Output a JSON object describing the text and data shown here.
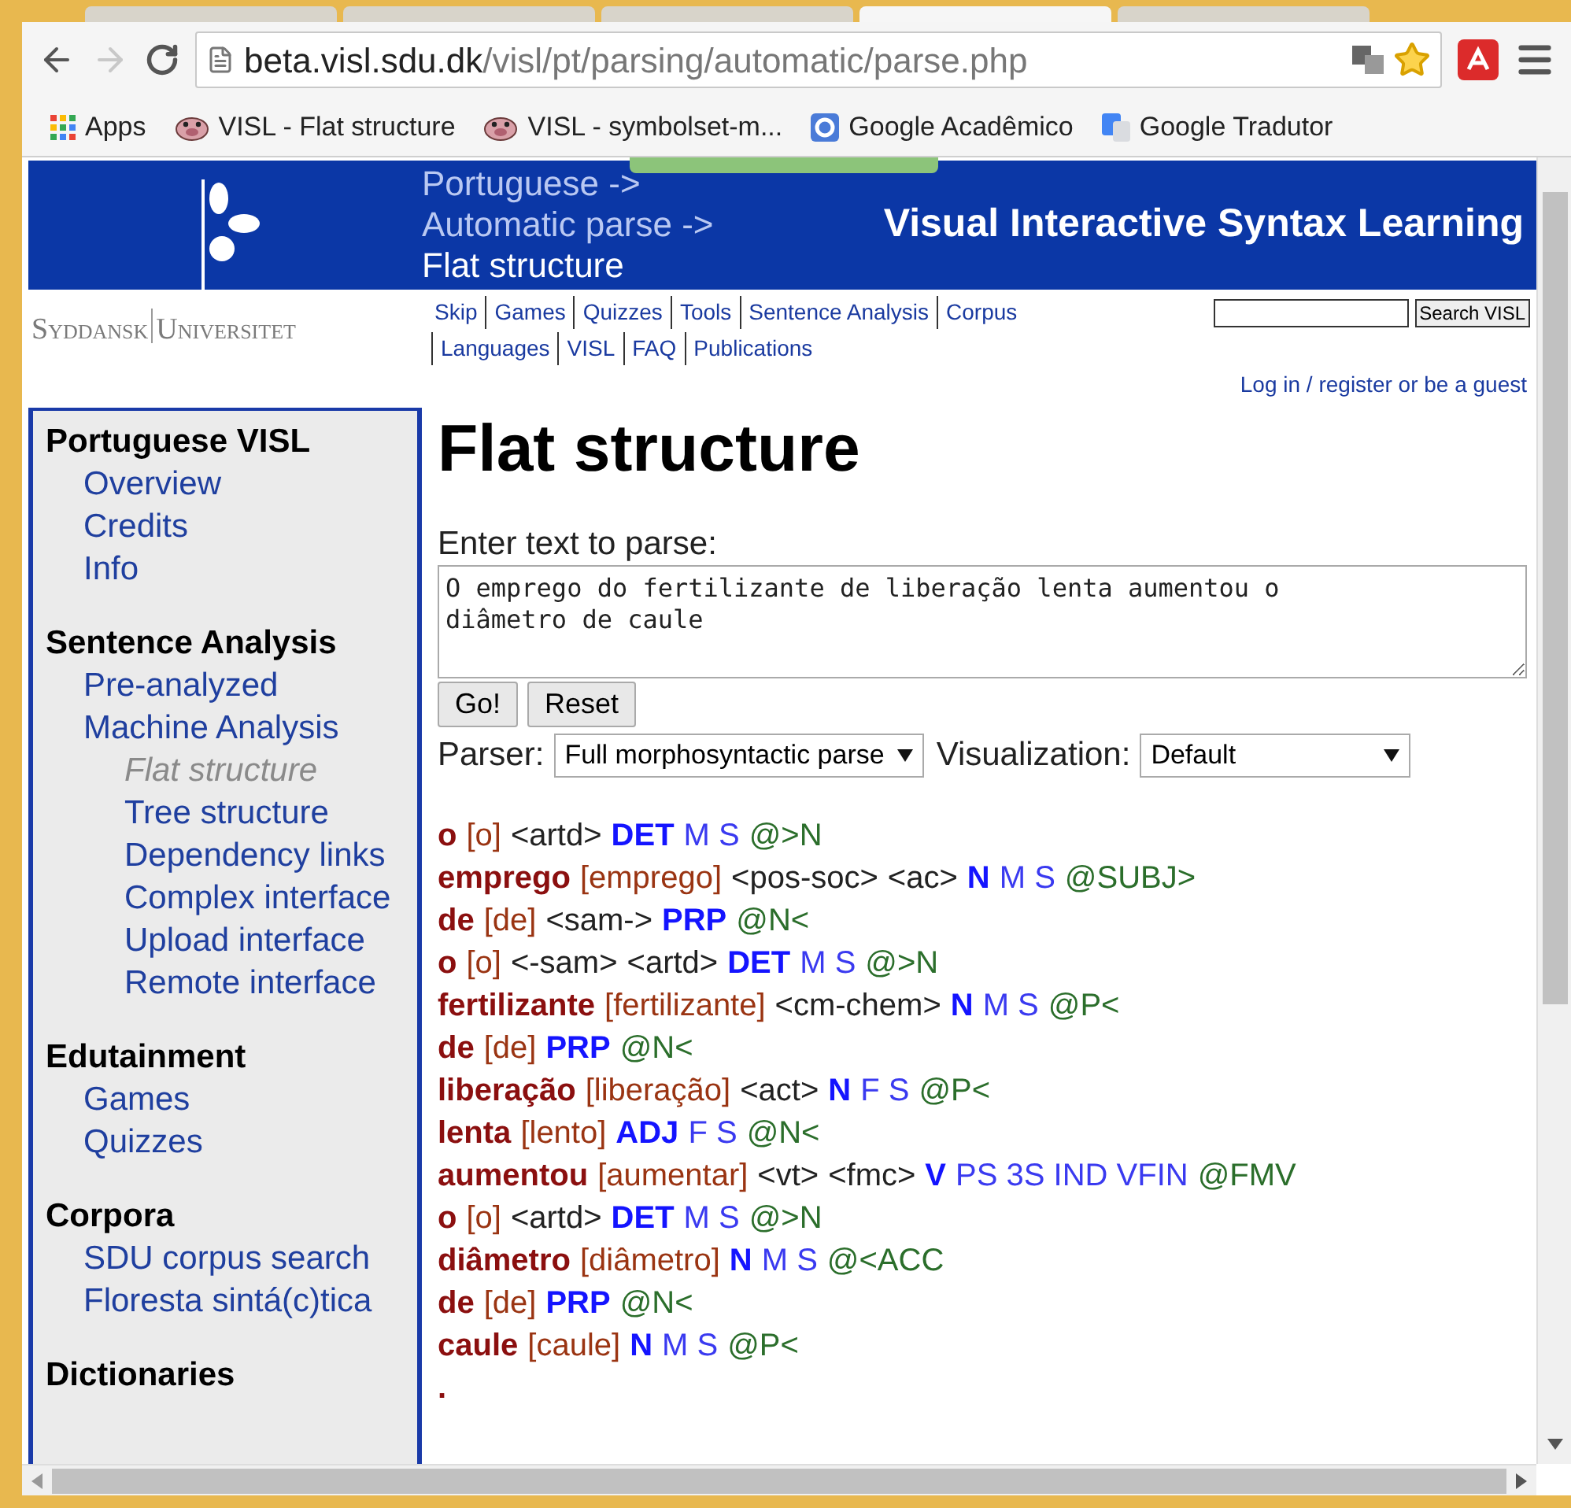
{
  "browser": {
    "tabs": [
      {
        "selected": false
      },
      {
        "selected": false
      },
      {
        "selected": false
      },
      {
        "selected": true
      },
      {
        "selected": false
      }
    ],
    "url_host": "beta.visl.sdu.dk",
    "url_path": "/visl/pt/parsing/automatic/parse.php",
    "bookmarks": [
      {
        "label": "Apps",
        "kind": "apps"
      },
      {
        "label": "VISL - Flat structure",
        "kind": "pig"
      },
      {
        "label": "VISL - symbolset-m...",
        "kind": "pig"
      },
      {
        "label": "Google Acadêmico",
        "kind": "scholar"
      },
      {
        "label": "Google Tradutor",
        "kind": "translate"
      }
    ]
  },
  "header": {
    "breadcrumb": [
      {
        "label": "Portuguese ->",
        "current": false
      },
      {
        "label": "Automatic parse ->",
        "current": false
      },
      {
        "label": "Flat structure",
        "current": true
      }
    ],
    "site_title": "Visual Interactive Syntax Learning",
    "logo_left": "Syddansk",
    "logo_right": "Universitet",
    "nav_row_1": [
      "Skip",
      "Games",
      "Quizzes",
      "Tools",
      "Sentence Analysis",
      "Corpus"
    ],
    "nav_row_2": [
      "Languages",
      "VISL",
      "FAQ",
      "Publications"
    ],
    "search_button": "Search VISL",
    "login": "Log in / register or be a guest"
  },
  "sidebar": [
    {
      "heading": "Portuguese VISL",
      "items": [
        {
          "label": "Overview",
          "selected": false
        },
        {
          "label": "Credits",
          "selected": false
        },
        {
          "label": "Info",
          "selected": false
        }
      ]
    },
    {
      "heading": "Sentence Analysis",
      "items": [
        {
          "label": "Pre-analyzed",
          "selected": false
        },
        {
          "label": "Machine Analysis",
          "selected": false,
          "children": [
            {
              "label": "Flat structure",
              "selected": true
            },
            {
              "label": "Tree structure",
              "selected": false
            },
            {
              "label": "Dependency links",
              "selected": false
            },
            {
              "label": "Complex interface",
              "selected": false
            },
            {
              "label": "Upload interface",
              "selected": false
            },
            {
              "label": "Remote interface",
              "selected": false
            }
          ]
        }
      ]
    },
    {
      "heading": "Edutainment",
      "items": [
        {
          "label": "Games",
          "selected": false
        },
        {
          "label": "Quizzes",
          "selected": false
        }
      ]
    },
    {
      "heading": "Corpora",
      "items": [
        {
          "label": "SDU corpus search",
          "selected": false
        },
        {
          "label": "Floresta sintá(c)tica",
          "selected": false
        }
      ]
    },
    {
      "heading": "Dictionaries"
    }
  ],
  "main": {
    "title": "Flat structure",
    "input_label": "Enter text to parse:",
    "input_value": "O emprego do fertilizante de liberação lenta aumentou o diâmetro de caule",
    "buttons": [
      "Go!",
      "Reset"
    ],
    "parser_label": "Parser:",
    "parser_value": "Full morphosyntactic parse",
    "visualization_label": "Visualization:",
    "visualization_value": "Default",
    "parse": [
      {
        "tokens": [
          {
            "kind": "word",
            "text": "o"
          },
          {
            "kind": "lemma",
            "text": "[o]"
          },
          {
            "kind": "sem",
            "text": "<artd>"
          },
          {
            "kind": "pos",
            "text": "DET"
          },
          {
            "kind": "morph",
            "text": "M S"
          },
          {
            "kind": "func",
            "text": "@>N"
          }
        ]
      },
      {
        "tokens": [
          {
            "kind": "word",
            "text": "emprego"
          },
          {
            "kind": "lemma",
            "text": "[emprego]"
          },
          {
            "kind": "sem",
            "text": "<pos-soc>"
          },
          {
            "kind": "sem",
            "text": "<ac>"
          },
          {
            "kind": "pos",
            "text": "N"
          },
          {
            "kind": "morph",
            "text": "M S"
          },
          {
            "kind": "func",
            "text": "@SUBJ>"
          }
        ]
      },
      {
        "tokens": [
          {
            "kind": "word",
            "text": "de"
          },
          {
            "kind": "lemma",
            "text": "[de]"
          },
          {
            "kind": "sem",
            "text": "<sam->"
          },
          {
            "kind": "pos",
            "text": "PRP"
          },
          {
            "kind": "func",
            "text": "@N<"
          }
        ]
      },
      {
        "tokens": [
          {
            "kind": "word",
            "text": "o"
          },
          {
            "kind": "lemma",
            "text": "[o]"
          },
          {
            "kind": "sem",
            "text": "<-sam>"
          },
          {
            "kind": "sem",
            "text": "<artd>"
          },
          {
            "kind": "pos",
            "text": "DET"
          },
          {
            "kind": "morph",
            "text": "M S"
          },
          {
            "kind": "func",
            "text": "@>N"
          }
        ]
      },
      {
        "tokens": [
          {
            "kind": "word",
            "text": "fertilizante"
          },
          {
            "kind": "lemma",
            "text": "[fertilizante]"
          },
          {
            "kind": "sem",
            "text": "<cm-chem>"
          },
          {
            "kind": "pos",
            "text": "N"
          },
          {
            "kind": "morph",
            "text": "M S"
          },
          {
            "kind": "func",
            "text": "@P<"
          }
        ]
      },
      {
        "tokens": [
          {
            "kind": "word",
            "text": "de"
          },
          {
            "kind": "lemma",
            "text": "[de]"
          },
          {
            "kind": "pos",
            "text": "PRP"
          },
          {
            "kind": "func",
            "text": "@N<"
          }
        ]
      },
      {
        "tokens": [
          {
            "kind": "word",
            "text": "liberação"
          },
          {
            "kind": "lemma",
            "text": "[liberação]"
          },
          {
            "kind": "sem",
            "text": "<act>"
          },
          {
            "kind": "pos",
            "text": "N"
          },
          {
            "kind": "morph",
            "text": "F S"
          },
          {
            "kind": "func",
            "text": "@P<"
          }
        ]
      },
      {
        "tokens": [
          {
            "kind": "word",
            "text": "lenta"
          },
          {
            "kind": "lemma",
            "text": "[lento]"
          },
          {
            "kind": "pos",
            "text": "ADJ"
          },
          {
            "kind": "morph",
            "text": "F S"
          },
          {
            "kind": "func",
            "text": "@N<"
          }
        ]
      },
      {
        "tokens": [
          {
            "kind": "word",
            "text": "aumentou"
          },
          {
            "kind": "lemma",
            "text": "[aumentar]"
          },
          {
            "kind": "sem",
            "text": "<vt>"
          },
          {
            "kind": "sem",
            "text": "<fmc>"
          },
          {
            "kind": "pos",
            "text": "V"
          },
          {
            "kind": "morph",
            "text": "PS 3S IND VFIN"
          },
          {
            "kind": "func",
            "text": "@FMV"
          }
        ]
      },
      {
        "tokens": [
          {
            "kind": "word",
            "text": "o"
          },
          {
            "kind": "lemma",
            "text": "[o]"
          },
          {
            "kind": "sem",
            "text": "<artd>"
          },
          {
            "kind": "pos",
            "text": "DET"
          },
          {
            "kind": "morph",
            "text": "M S"
          },
          {
            "kind": "func",
            "text": "@>N"
          }
        ]
      },
      {
        "tokens": [
          {
            "kind": "word",
            "text": "diâmetro"
          },
          {
            "kind": "lemma",
            "text": "[diâmetro]"
          },
          {
            "kind": "pos",
            "text": "N"
          },
          {
            "kind": "morph",
            "text": "M S"
          },
          {
            "kind": "func",
            "text": "@<ACC"
          }
        ]
      },
      {
        "tokens": [
          {
            "kind": "word",
            "text": "de"
          },
          {
            "kind": "lemma",
            "text": "[de]"
          },
          {
            "kind": "pos",
            "text": "PRP"
          },
          {
            "kind": "func",
            "text": "@N<"
          }
        ]
      },
      {
        "tokens": [
          {
            "kind": "word",
            "text": "caule"
          },
          {
            "kind": "lemma",
            "text": "[caule]"
          },
          {
            "kind": "pos",
            "text": "N"
          },
          {
            "kind": "morph",
            "text": "M S"
          },
          {
            "kind": "func",
            "text": "@P<"
          }
        ]
      },
      {
        "tokens": [
          {
            "kind": "punct",
            "text": "."
          }
        ]
      }
    ]
  }
}
